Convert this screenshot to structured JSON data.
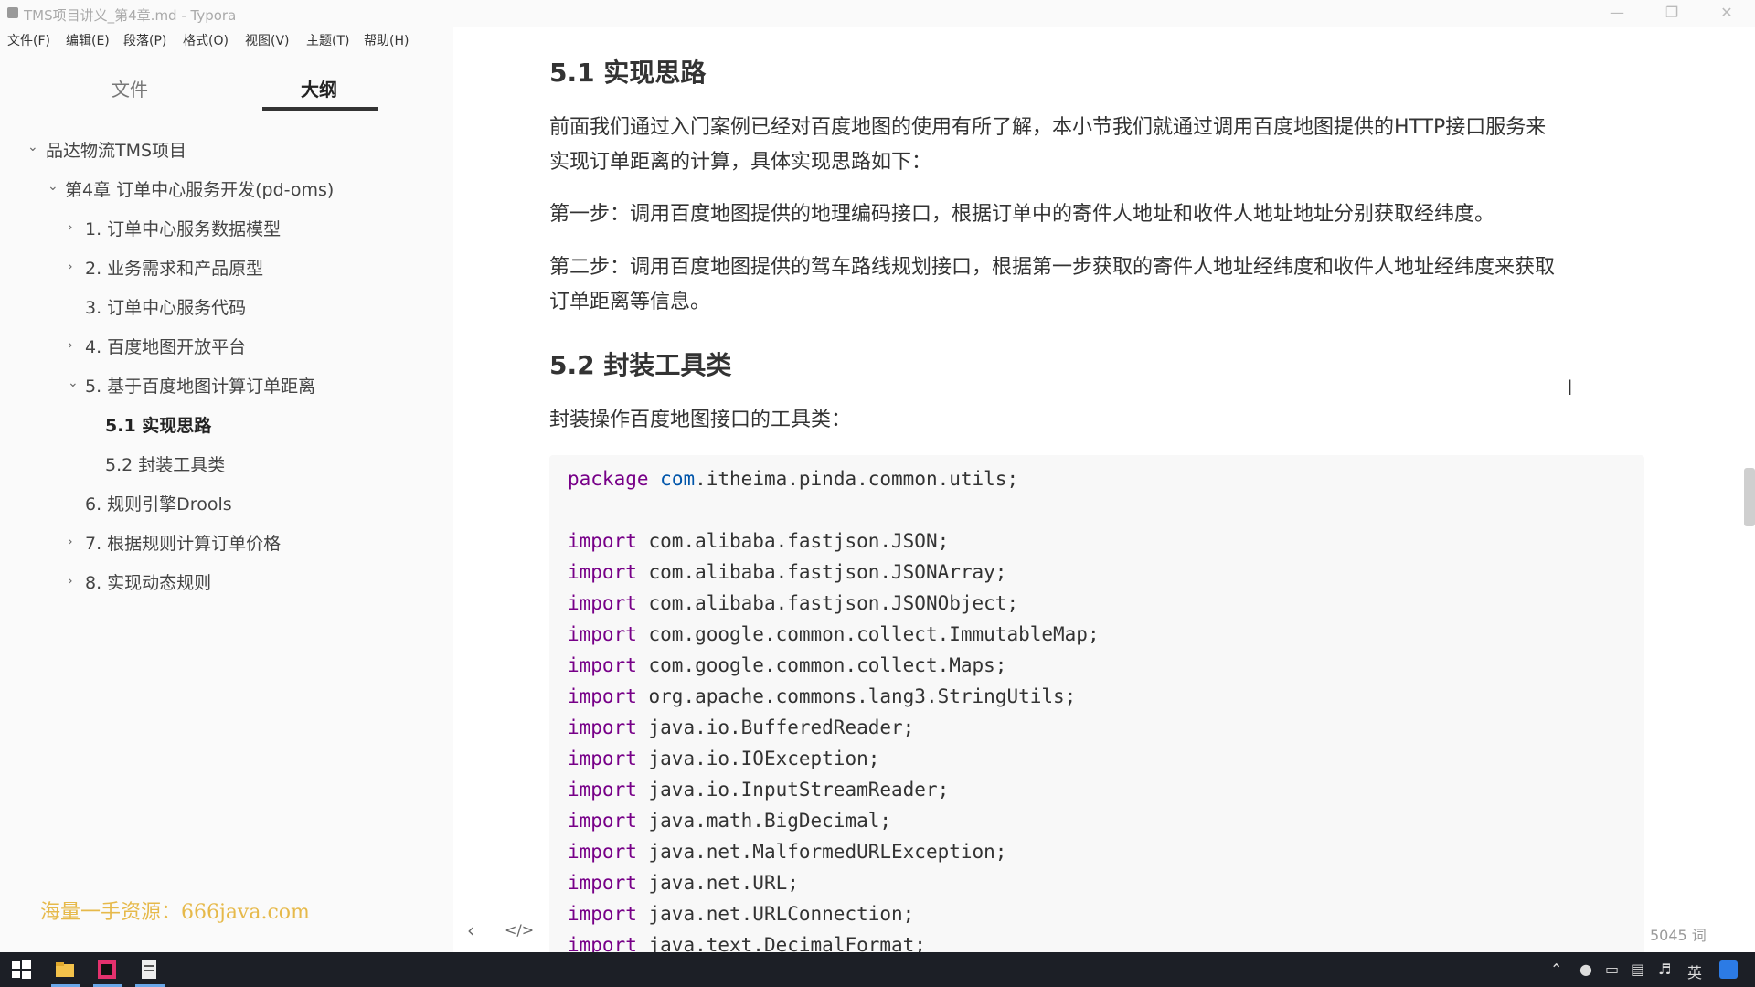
{
  "window": {
    "title": "TMS项目讲义_第4章.md - Typora"
  },
  "menu": [
    "文件(F)",
    "编辑(E)",
    "段落(P)",
    "格式(O)",
    "视图(V)",
    "主题(T)",
    "帮助(H)"
  ],
  "sidebar": {
    "tabs": [
      "文件",
      "大纲"
    ],
    "active_tab": "大纲",
    "outline": [
      {
        "label": "品达物流TMS项目",
        "level": 0,
        "expanded": true
      },
      {
        "label": "第4章 订单中心服务开发(pd-oms)",
        "level": 1,
        "expanded": true
      },
      {
        "label": "1. 订单中心服务数据模型",
        "level": 2,
        "expanded": false
      },
      {
        "label": "2. 业务需求和产品原型",
        "level": 2,
        "expanded": false
      },
      {
        "label": "3. 订单中心服务代码",
        "level": 2
      },
      {
        "label": "4. 百度地图开放平台",
        "level": 2,
        "expanded": false
      },
      {
        "label": "5. 基于百度地图计算订单距离",
        "level": 2,
        "expanded": true
      },
      {
        "label": "5.1 实现思路",
        "level": 3,
        "active": true
      },
      {
        "label": "5.2 封装工具类",
        "level": 3
      },
      {
        "label": "6. 规则引擎Drools",
        "level": 2
      },
      {
        "label": "7. 根据规则计算订单价格",
        "level": 2,
        "expanded": false
      },
      {
        "label": "8. 实现动态规则",
        "level": 2,
        "expanded": false
      }
    ],
    "watermark": "海量一手资源：666java.com"
  },
  "content": {
    "h_51": "5.1 实现思路",
    "p_intro_1": "前面我们通过入门案例已经对百度地图的使用有所了解，本小节我们就通过调用百度地图提供的HTTP接口服务来",
    "p_intro_2": "实现订单距离的计算，具体实现思路如下：",
    "p_step1": "第一步：调用百度地图提供的地理编码接口，根据订单中的寄件人地址和收件人地址地址分别获取经纬度。",
    "p_step2_1": "第二步：调用百度地图提供的驾车路线规划接口，根据第一步获取的寄件人地址经纬度和收件人地址经纬度来获取",
    "p_step2_2": "订单距离等信息。",
    "h_52": "5.2 封装工具类",
    "p_tool": "封装操作百度地图接口的工具类：",
    "code": {
      "package_kw": "package",
      "package_name_1": "com",
      "package_name_2": ".itheima.pinda.common.utils;",
      "import_kw": "import",
      "imports": [
        "com.alibaba.fastjson.JSON;",
        "com.alibaba.fastjson.JSONArray;",
        "com.alibaba.fastjson.JSONObject;",
        "com.google.common.collect.ImmutableMap;",
        "com.google.common.collect.Maps;",
        "org.apache.commons.lang3.StringUtils;",
        "java.io.BufferedReader;",
        "java.io.IOException;",
        "java.io.InputStreamReader;",
        "java.math.BigDecimal;",
        "java.net.MalformedURLException;",
        "java.net.URL;",
        "java.net.URLConnection;",
        "java.text.DecimalFormat;"
      ]
    }
  },
  "statusbar": {
    "word_count": "5045 词"
  },
  "tray": {
    "ime": "英"
  },
  "colors": {
    "keyword": "#770088",
    "package": "#0055aa",
    "code_bg": "#f8f8f8",
    "sidebar_bg": "#fafafa"
  }
}
